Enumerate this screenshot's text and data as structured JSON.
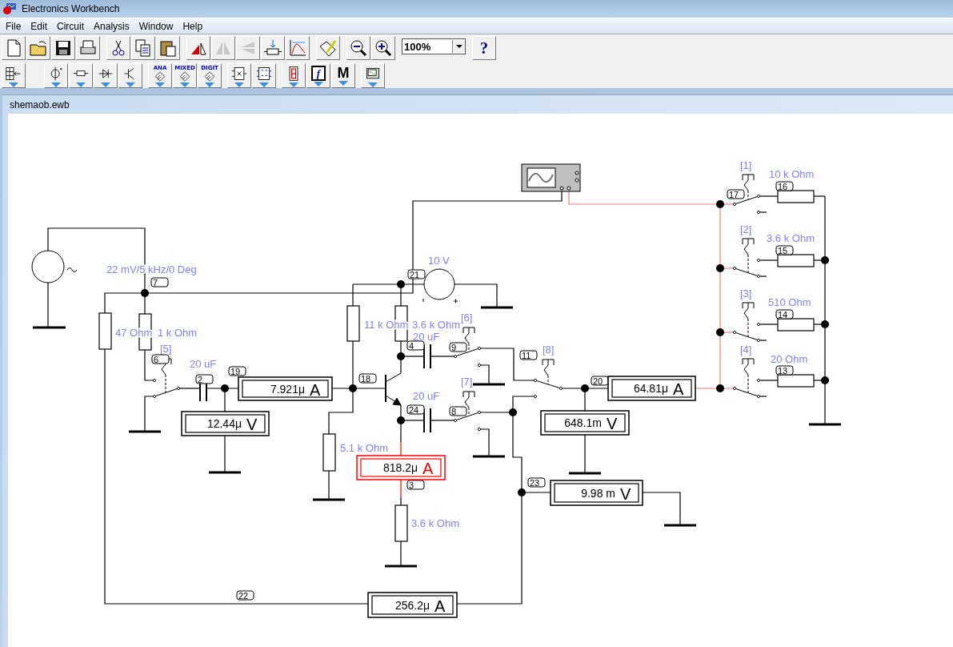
{
  "window": {
    "title": "Electronics Workbench"
  },
  "menu": [
    {
      "label": "File"
    },
    {
      "label": "Edit"
    },
    {
      "label": "Circuit"
    },
    {
      "label": "Analysis"
    },
    {
      "label": "Window"
    },
    {
      "label": "Help"
    }
  ],
  "toolbar_rows": [
    [
      [
        {
          "kind": "new",
          "disabled": false
        },
        {
          "kind": "open",
          "disabled": false
        },
        {
          "kind": "save",
          "disabled": false
        },
        {
          "kind": "print",
          "disabled": false
        }
      ],
      [
        {
          "kind": "cut",
          "disabled": false
        },
        {
          "kind": "copy",
          "disabled": false
        },
        {
          "kind": "paste",
          "disabled": false
        }
      ],
      [
        {
          "kind": "rotate",
          "disabled": false
        },
        {
          "kind": "flip_h",
          "disabled": true
        },
        {
          "kind": "flip_v",
          "disabled": true
        },
        {
          "kind": "properties",
          "disabled": false
        },
        {
          "kind": "graph",
          "disabled": false
        }
      ],
      [
        {
          "kind": "description",
          "disabled": false
        }
      ],
      [
        {
          "kind": "zoom_out",
          "disabled": false
        },
        {
          "kind": "zoom_in",
          "disabled": false
        }
      ],
      [
        {
          "kind": "combo",
          "value": "100%",
          "disabled": false
        }
      ],
      [
        {
          "kind": "help",
          "label": "?",
          "disabled": false
        }
      ]
    ],
    [
      [
        {
          "kind": "parts_bin",
          "disabled": false
        }
      ],
      [
        {
          "kind": "sources",
          "disabled": false
        },
        {
          "kind": "basic",
          "disabled": false
        },
        {
          "kind": "diodes",
          "disabled": false
        },
        {
          "kind": "transistors",
          "disabled": false
        }
      ],
      [
        {
          "kind": "ic",
          "label": "ANA",
          "disabled": false
        },
        {
          "kind": "ic",
          "label": "MIXED",
          "disabled": false
        },
        {
          "kind": "ic",
          "label": "DIGIT",
          "disabled": false
        }
      ],
      [
        {
          "kind": "logic_gates",
          "disabled": false
        },
        {
          "kind": "flip_flops",
          "disabled": false
        }
      ],
      [
        {
          "kind": "indicators",
          "disabled": false
        },
        {
          "kind": "chip",
          "label": "f",
          "disabled": false
        },
        {
          "kind": "letter",
          "label": "M",
          "disabled": false
        }
      ],
      [
        {
          "kind": "instruments",
          "disabled": false
        }
      ]
    ]
  ],
  "document": {
    "title": "shemaob.ewb"
  },
  "schematic": {
    "component_labels": [
      "10 k Ohm",
      "10 V",
      "22 mV/5 kHz/0 Deg",
      "3.6 k Ohm",
      "510  Ohm",
      "11 k Ohm",
      "3.6 k Ohm",
      "47  Ohm",
      "1 k Ohm",
      "20 uF",
      "20 uF",
      "20  Ohm",
      "20 uF",
      "5.1 k Ohm",
      "3.6 k Ohm"
    ],
    "node_tags": [
      "16",
      "17",
      "15",
      "21",
      "7",
      "14",
      "4",
      "9",
      "11",
      "6",
      "13",
      "2",
      "19",
      "18",
      "20",
      "24",
      "8",
      "3",
      "23",
      "22"
    ],
    "switches": [
      {
        "key": "[1]",
        "up": true
      },
      {
        "key": "[2]",
        "up": false
      },
      {
        "key": "[3]",
        "up": false
      },
      {
        "key": "[6]",
        "up": true
      },
      {
        "key": "[5]",
        "up": false
      },
      {
        "key": "[8]",
        "up": true
      },
      {
        "key": "[4]",
        "up": false
      },
      {
        "key": "[7]",
        "up": true
      }
    ],
    "meters": [
      {
        "reading": "7.921μ",
        "unit": "A",
        "selected": false
      },
      {
        "reading": "64.81μ",
        "unit": "A",
        "selected": false
      },
      {
        "reading": "12.44μ",
        "unit": "V",
        "selected": false
      },
      {
        "reading": "648.1m",
        "unit": "V",
        "selected": false
      },
      {
        "reading": "818.2μ",
        "unit": "A",
        "selected": true
      },
      {
        "reading": "9.98 m",
        "unit": "V",
        "selected": false
      },
      {
        "reading": "256.2μ",
        "unit": "A",
        "selected": false
      }
    ]
  }
}
